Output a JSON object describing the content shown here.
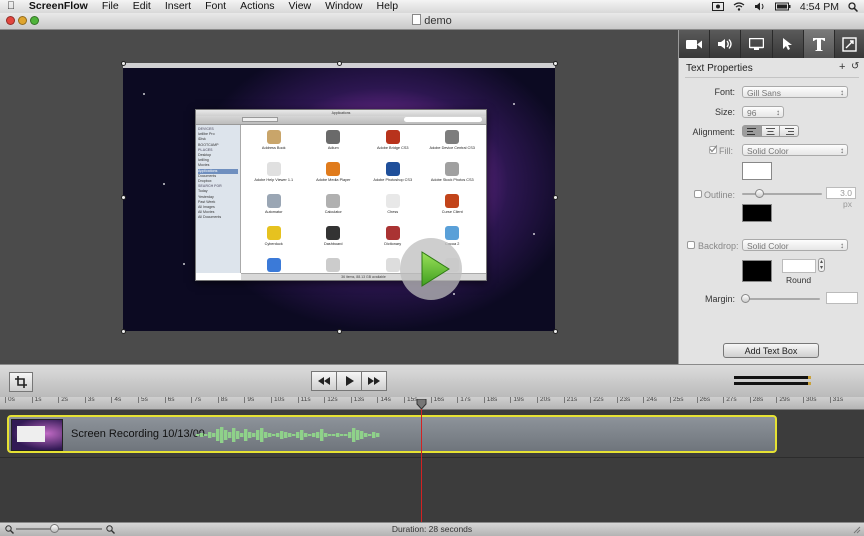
{
  "menubar": {
    "apple": "",
    "app_name": "ScreenFlow",
    "items": [
      "File",
      "Edit",
      "Insert",
      "Font",
      "Actions",
      "View",
      "Window",
      "Help"
    ],
    "clock": "4:54 PM"
  },
  "window": {
    "title": "demo"
  },
  "finder": {
    "title": "Applications",
    "status": "36 items, 88.13 GB available",
    "sidebar_headers": [
      "DEVICES",
      "PLACES",
      "SEARCH FOR"
    ],
    "sidebar_devices": [
      "Iwillbe Pro",
      "iDisk",
      "BOOTCAMP"
    ],
    "sidebar_places": [
      "Desktop",
      "Iwilling",
      "Movies",
      "Applications",
      "Documents",
      "Dropbox"
    ],
    "sidebar_search": [
      "Today",
      "Yesterday",
      "Past Week",
      "All Images",
      "All Movies",
      "All Documents"
    ],
    "apps": [
      "Address Book",
      "Adium",
      "Adobe Bridge CS3",
      "Adobe Device Central CS3",
      "Adobe Help Viewer 1.1",
      "Adobe Media Player",
      "Adobe Photoshop CS3",
      "Adobe Stock Photos CS3",
      "Automator",
      "Calculator",
      "Chess",
      "Curse Client",
      "Cyberduck",
      "Dashboard",
      "Dictionary",
      "Cocoa 2",
      "Dropbox",
      "",
      "",
      ""
    ]
  },
  "inspector": {
    "title": "Text Properties",
    "add_symbol": "+",
    "reset_symbol": "↺",
    "font_label": "Font:",
    "font_value": "Gill Sans",
    "size_label": "Size:",
    "size_value": "96",
    "alignment_label": "Alignment:",
    "fill_label": "Fill:",
    "fill_value": "Solid Color",
    "fill_checked": true,
    "fill_color": "#ffffff",
    "outline_label": "Outline:",
    "outline_value": "3.0 px",
    "outline_checked": false,
    "outline_color": "#000000",
    "backdrop_label": "Backdrop:",
    "backdrop_value": "Solid Color",
    "backdrop_checked": false,
    "backdrop_color": "#000000",
    "round_label": "Round",
    "margin_label": "Margin:",
    "add_text_box": "Add Text Box",
    "tabs": [
      "video-camera-icon",
      "speaker-icon",
      "monitor-icon",
      "pointer-icon",
      "text-icon",
      "annotation-icon"
    ],
    "active_tab": 4
  },
  "timeline": {
    "ruler": [
      "0s",
      "1s",
      "2s",
      "3s",
      "4s",
      "5s",
      "6s",
      "7s",
      "8s",
      "9s",
      "10s",
      "11s",
      "12s",
      "13s",
      "14s",
      "15s",
      "16s",
      "17s",
      "18s",
      "19s",
      "20s",
      "21s",
      "22s",
      "23s",
      "24s",
      "25s",
      "26s",
      "27s",
      "28s",
      "29s",
      "30s",
      "31s"
    ],
    "clip_label": "Screen Recording 10/13/09",
    "clip_border_color": "#e6e233",
    "playhead_color": "#d22222"
  },
  "status": {
    "duration": "Duration: 28 seconds"
  }
}
